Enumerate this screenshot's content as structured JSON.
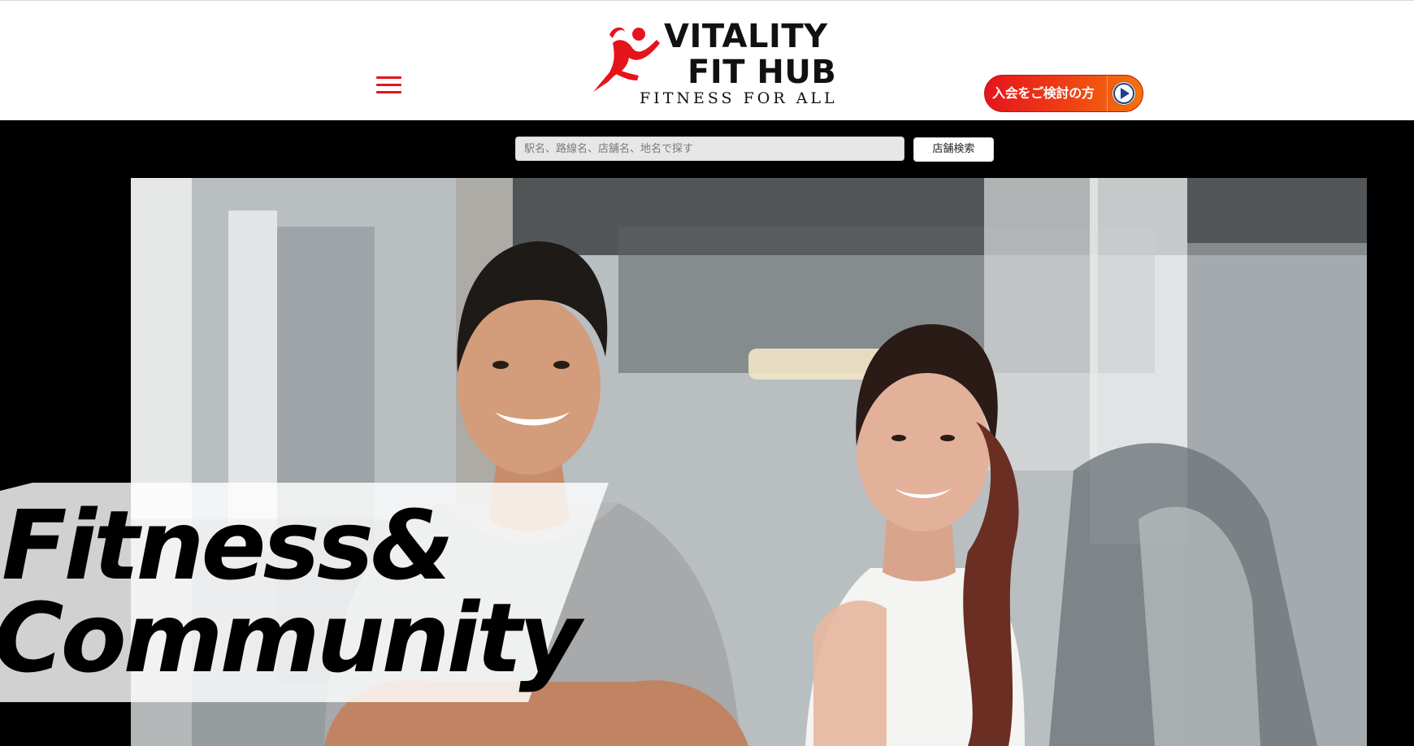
{
  "header": {
    "logo": {
      "name_line1": "VITALITY",
      "name_line2": "FIT HUB",
      "tagline": "FITNESS FOR ALL"
    },
    "menu_icon": "hamburger-menu-icon",
    "join_button": {
      "label": "入会をご検討の方",
      "icon": "play-circle-icon"
    }
  },
  "search": {
    "placeholder": "駅名、路線名、店舗名、地名で探す",
    "value": "",
    "button_label": "店舗検索"
  },
  "hero": {
    "headline_line1": "Fitness&",
    "headline_line2": "Community"
  },
  "colors": {
    "accent_red": "#e5141b",
    "accent_orange": "#f2750c",
    "background": "#000000",
    "header_bg": "#ffffff"
  }
}
